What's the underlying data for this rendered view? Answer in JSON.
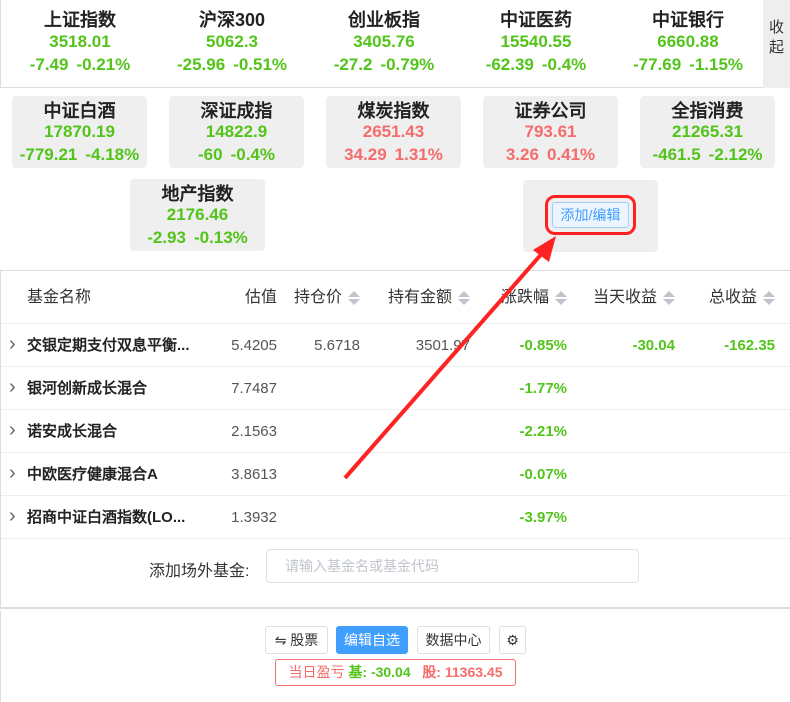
{
  "top_indices": [
    {
      "name": "上证指数",
      "value": "3518.01",
      "change": "-7.49",
      "pct": "-0.21%"
    },
    {
      "name": "沪深300",
      "value": "5062.3",
      "change": "-25.96",
      "pct": "-0.51%"
    },
    {
      "name": "创业板指",
      "value": "3405.76",
      "change": "-27.2",
      "pct": "-0.79%"
    },
    {
      "name": "中证医药",
      "value": "15540.55",
      "change": "-62.39",
      "pct": "-0.4%"
    },
    {
      "name": "中证银行",
      "value": "6660.88",
      "change": "-77.69",
      "pct": "-1.15%"
    }
  ],
  "collapse_label": "收起",
  "cards": [
    {
      "name": "中证白酒",
      "value": "17870.19",
      "change": "-779.21",
      "pct": "-4.18%",
      "trend": "down"
    },
    {
      "name": "深证成指",
      "value": "14822.9",
      "change": "-60",
      "pct": "-0.4%",
      "trend": "down"
    },
    {
      "name": "煤炭指数",
      "value": "2651.43",
      "change": "34.29",
      "pct": "1.31%",
      "trend": "up"
    },
    {
      "name": "证券公司",
      "value": "793.61",
      "change": "3.26",
      "pct": "0.41%",
      "trend": "up"
    },
    {
      "name": "全指消费",
      "value": "21265.31",
      "change": "-461.5",
      "pct": "-2.12%",
      "trend": "down"
    },
    {
      "name": "地产指数",
      "value": "2176.46",
      "change": "-2.93",
      "pct": "-0.13%",
      "trend": "down"
    }
  ],
  "add_edit_label": "添加/编辑",
  "table": {
    "headers": [
      "基金名称",
      "估值",
      "持仓价",
      "持有金额",
      "涨跌幅",
      "当天收益",
      "总收益"
    ],
    "rows": [
      {
        "name": "交银定期支付双息平衡...",
        "est": "5.4205",
        "cost": "5.6718",
        "amount": "3501.97",
        "pct": "-0.85%",
        "today": "-30.04",
        "total": "-162.35"
      },
      {
        "name": "银河创新成长混合",
        "est": "7.7487",
        "cost": "",
        "amount": "",
        "pct": "-1.77%",
        "today": "",
        "total": ""
      },
      {
        "name": "诺安成长混合",
        "est": "2.1563",
        "cost": "",
        "amount": "",
        "pct": "-2.21%",
        "today": "",
        "total": ""
      },
      {
        "name": "中欧医疗健康混合A",
        "est": "3.8613",
        "cost": "",
        "amount": "",
        "pct": "-0.07%",
        "today": "",
        "total": ""
      },
      {
        "name": "招商中证白酒指数(LO...",
        "est": "1.3932",
        "cost": "",
        "amount": "",
        "pct": "-3.97%",
        "today": "",
        "total": ""
      }
    ]
  },
  "add_fund": {
    "label": "添加场外基金:",
    "placeholder": "请输入基金名或基金代码"
  },
  "footer": {
    "stocks": "⇋ 股票",
    "edit": "编辑自选",
    "data_center": "数据中心",
    "settings": "⚙",
    "summary_label": "当日盈亏",
    "fund_label": "基:",
    "fund_value": "-30.04",
    "stock_label": "股:",
    "stock_value": "11363.45"
  },
  "colors": {
    "down": "#52c41a",
    "up": "#f56c6c",
    "accent": "#409eff"
  }
}
